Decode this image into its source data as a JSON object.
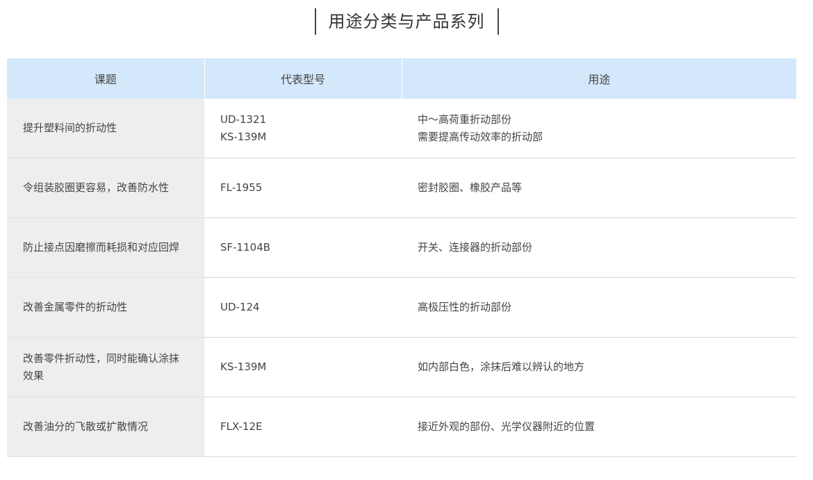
{
  "page_title": "用途分类与产品系列",
  "table": {
    "headers": [
      "课题",
      "代表型号",
      "用途"
    ],
    "rows": [
      {
        "topic": "提升塑料间的折动性",
        "models": [
          "UD-1321",
          "KS-139M"
        ],
        "uses": [
          "中〜高荷重折动部份",
          "需要提高传动效率的折动部"
        ]
      },
      {
        "topic": "令组装胶圈更容易，改善防水性",
        "models": [
          "FL-1955"
        ],
        "uses": [
          "密封胶圈、橡胶产品等"
        ]
      },
      {
        "topic": "防止接点因磨擦而耗损和对应回焊",
        "models": [
          "SF-1104B"
        ],
        "uses": [
          "开关、连接器的折动部份"
        ]
      },
      {
        "topic": "改善金属零件的折动性",
        "models": [
          "UD-124"
        ],
        "uses": [
          "高极压性的折动部份"
        ]
      },
      {
        "topic": "改善零件折动性，同时能确认涂抹效果",
        "models": [
          "KS-139M"
        ],
        "uses": [
          "如内部白色，涂抹后难以辨认的地方"
        ]
      },
      {
        "topic": "改善油分的飞散或扩散情况",
        "models": [
          "FLX-12E"
        ],
        "uses": [
          "接近外观的部份、光学仪器附近的位置"
        ]
      }
    ]
  }
}
